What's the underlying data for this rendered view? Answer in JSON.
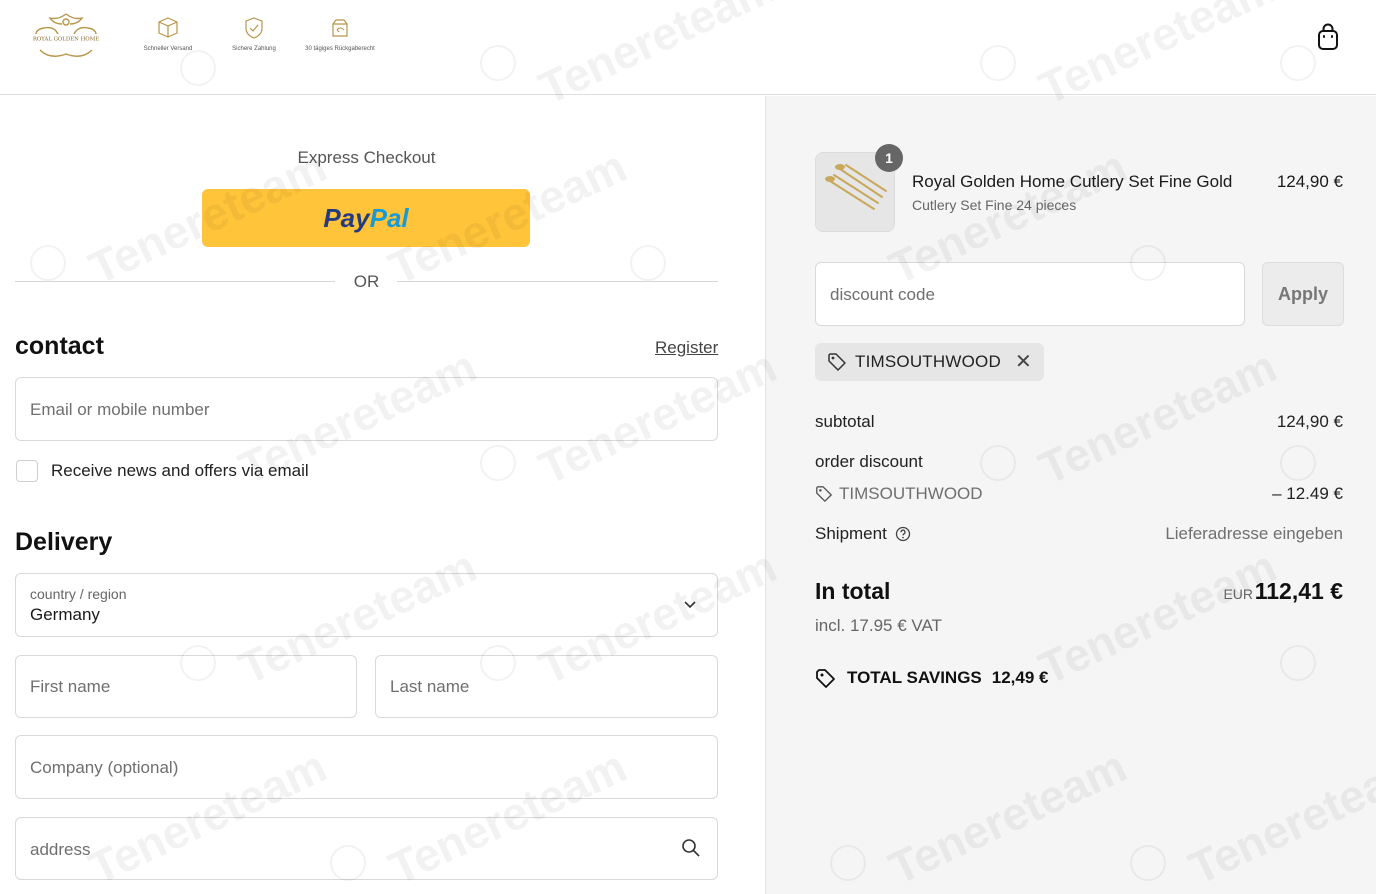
{
  "header": {
    "logo_text": "ROYAL GOLDEN HOME",
    "badges": [
      {
        "icon": "package-icon",
        "label": "Schneller Versand"
      },
      {
        "icon": "shield-check-icon",
        "label": "Sichere Zahlung"
      },
      {
        "icon": "return-box-icon",
        "label": "30 tägiges Rückgaberecht"
      }
    ],
    "cart_icon": "shopping-bag-icon"
  },
  "express": {
    "label": "Express Checkout",
    "paypal_pay": "Pay",
    "paypal_pal": "Pal",
    "or_label": "OR"
  },
  "contact": {
    "title": "contact",
    "register_link": "Register",
    "email_placeholder": "Email or mobile number",
    "newsletter_label": "Receive news and offers via email",
    "newsletter_checked": false
  },
  "delivery": {
    "title": "Delivery",
    "country_label": "country / region",
    "country_value": "Germany",
    "first_name_placeholder": "First name",
    "last_name_placeholder": "Last name",
    "company_placeholder": "Company (optional)",
    "address_placeholder": "address"
  },
  "summary": {
    "product": {
      "quantity": "1",
      "title": "Royal Golden Home Cutlery Set Fine Gold",
      "variant": "Cutlery Set Fine 24 pieces",
      "price": "124,90 €"
    },
    "discount_placeholder": "discount code",
    "apply_label": "Apply",
    "applied_code": "TIMSOUTHWOOD",
    "subtotal_label": "subtotal",
    "subtotal_value": "124,90 €",
    "order_discount_label": "order discount",
    "order_discount_code": "TIMSOUTHWOOD",
    "order_discount_value": "– 12.49 €",
    "shipment_label": "Shipment",
    "shipment_value": "Lieferadresse eingeben",
    "total_label": "In total",
    "total_currency": "EUR",
    "total_value": "112,41 €",
    "vat_label": "incl. 17.95 € VAT",
    "savings_label": "TOTAL SAVINGS",
    "savings_value": "12,49 €"
  },
  "watermark_text": "Tenereteam",
  "colors": {
    "paypal_yellow": "#ffc439",
    "paypal_dark_blue": "#253b80",
    "paypal_light_blue": "#179bd7",
    "summary_bg": "#f5f5f5"
  }
}
